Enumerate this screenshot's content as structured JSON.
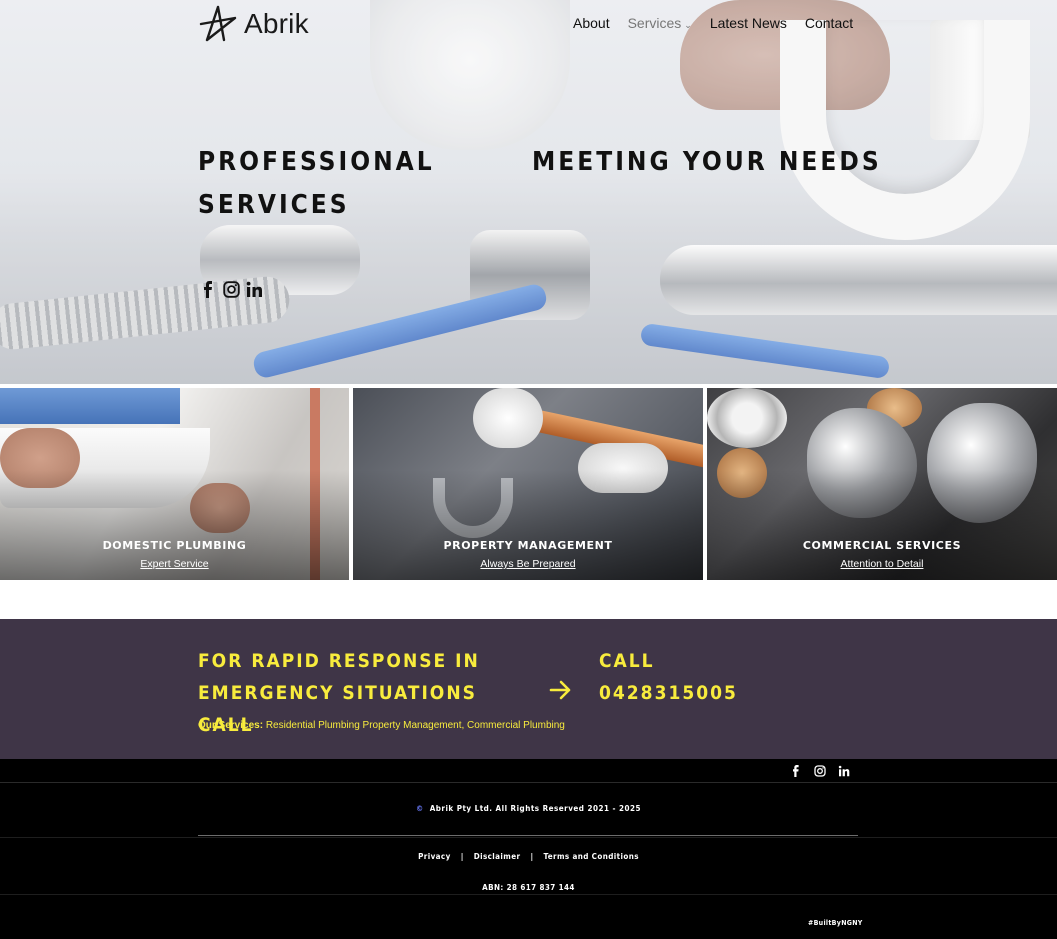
{
  "brand": {
    "name": "Abrik",
    "logo_icon": "star-logo-icon"
  },
  "nav": {
    "items": [
      {
        "label": "About"
      },
      {
        "label": "Services",
        "has_dropdown": true
      },
      {
        "label": "Latest News"
      },
      {
        "label": "Contact"
      }
    ]
  },
  "hero": {
    "title_left_line1": "PROFESSIONAL",
    "title_left_line2": "SERVICES",
    "title_right": "MEETING YOUR NEEDS",
    "social_icons": [
      "facebook-icon",
      "instagram-icon",
      "linkedin-icon"
    ]
  },
  "cards": [
    {
      "title": "DOMESTIC PLUMBING",
      "link": "Expert Service"
    },
    {
      "title": "PROPERTY MANAGEMENT",
      "link": "Always Be Prepared"
    },
    {
      "title": "COMMERCIAL SERVICES",
      "link": "Attention to Detail"
    }
  ],
  "cta": {
    "line1": "FOR RAPID RESPONSE IN",
    "line2": "EMERGENCY SITUATIONS CALL",
    "call_label": "CALL",
    "phone": "0428315005",
    "arrow_icon": "arrow-right-icon",
    "services_label": "Our Services:",
    "services_text": " Residential Plumbing Property Management, Commercial Plumbing",
    "text_color": "#f8ec3d",
    "bg_color": "#3f3547"
  },
  "footer": {
    "social_icons": [
      "facebook-icon",
      "instagram-icon",
      "linkedin-icon"
    ],
    "copyright_symbol": "©",
    "copyright": "Abrik Pty Ltd. All Rights Reserved 2021 - 2025",
    "links": [
      "Privacy",
      "Disclaimer",
      "Terms and Conditions"
    ],
    "separator": "|",
    "abn": "ABN: 28 617 837 144",
    "credit": "#BuiltByNGNY"
  }
}
